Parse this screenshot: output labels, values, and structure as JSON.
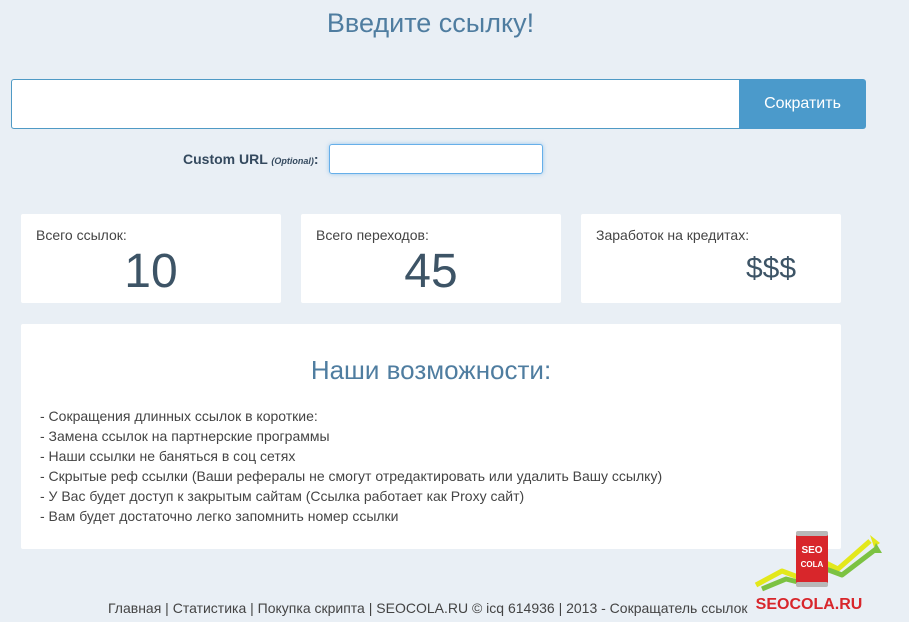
{
  "header": {
    "title": "Введите ссылку!"
  },
  "shortener": {
    "url_value": "",
    "submit_label": "Сократить"
  },
  "custom_url": {
    "label": "Custom URL",
    "optional": "(Optional)",
    "colon": ":",
    "value": ""
  },
  "stats": [
    {
      "label": "Всего ссылок:",
      "value": "10"
    },
    {
      "label": "Всего переходов:",
      "value": "45"
    },
    {
      "label": "Заработок на кредитах:",
      "value": "$$$"
    }
  ],
  "features": {
    "title": "Наши возможности:",
    "items": [
      "- Сокращения длинных ссылок в короткие:",
      "- Замена ссылок на партнерские программы",
      "- Наши ссылки не баняться в соц сетях",
      "- Скрытые реф ссылки (Ваши рефералы не смогут отредактировать или удалить Вашу ссылку)",
      "- У Вас будет доступ к закрытым сайтам (Ссылка работает как Proxy сайт)",
      "- Вам будет достаточно легко запомнить номер ссылки"
    ]
  },
  "footer": {
    "links": [
      "Главная",
      "Статистика",
      "Покупка скрипта"
    ],
    "separator": " | ",
    "text": "SEOCOLA.RU © icq 614936 | 2013 - Сокращатель ссылок"
  },
  "logo": {
    "can_text_1": "SEO",
    "can_text_2": "COLA",
    "brand": "SEOCOLA.RU",
    "colors": {
      "can": "#d8262b",
      "arrow_green": "#7cc242",
      "arrow_yellow": "#e3e81b",
      "brand_text": "#d8262b"
    }
  }
}
